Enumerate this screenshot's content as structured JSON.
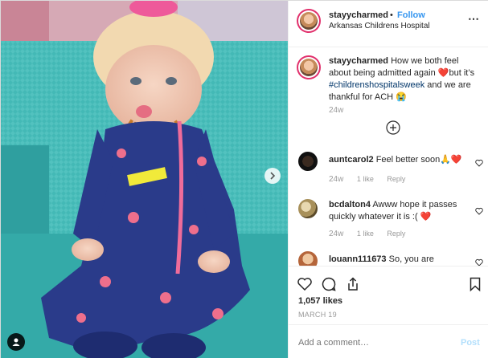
{
  "post": {
    "username": "stayycharmed",
    "separator": "•",
    "follow_label": "Follow",
    "location": "Arkansas Childrens Hospital",
    "more_icon": "more-icon",
    "caption": {
      "username": "stayycharmed",
      "text_before": "How we both feel about being admitted again ",
      "heart": "❤️",
      "text_middle": "but it’s ",
      "hashtag": "#childrenshospitalsweek",
      "text_after": " and we are thankful for ACH ",
      "emoji": "😭",
      "time": "24w"
    },
    "load_more_icon": "plus-circle-icon"
  },
  "comments": [
    {
      "username": "auntcarol2",
      "text": "Feel better soon",
      "emoji": "🙏❤️",
      "time": "24w",
      "likes": "1 like",
      "reply": "Reply"
    },
    {
      "username": "bcdalton4",
      "text": "Awww hope it passes quickly whatever it is :( ",
      "emoji": "❤️",
      "time": "24w",
      "likes": "1 like",
      "reply": "Reply"
    },
    {
      "username": "louann111673",
      "text": "So, you are admitted? They should have just",
      "emoji": "",
      "time": "",
      "likes": "",
      "reply": ""
    }
  ],
  "actions": {
    "likes": "1,057 likes",
    "date": "MARCH 19",
    "comment_placeholder": "Add a comment…",
    "post_label": "Post"
  },
  "colors": {
    "accent": "#3897f0",
    "hashtag": "#003569",
    "muted": "#999999",
    "post_disabled": "#b2dffc"
  }
}
